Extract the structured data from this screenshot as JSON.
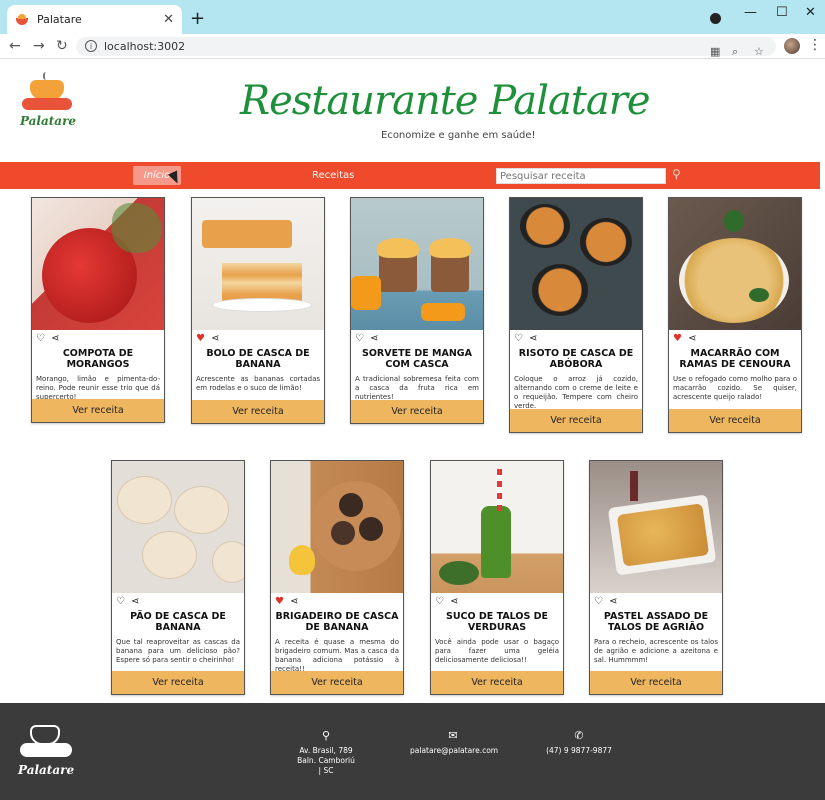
{
  "browser": {
    "tab_title": "Palatare",
    "close": "✕",
    "new_tab": "+",
    "url": "localhost:3002",
    "min": "—",
    "max": "☐",
    "closewin": "✕"
  },
  "header": {
    "logo_text": "Palatare",
    "title": "Restaurante Palatare",
    "subtitle": "Economize e ganhe em saúde!"
  },
  "nav": {
    "inicio": "Início",
    "receitas": "Receitas",
    "search_placeholder": "Pesquisar receita"
  },
  "cards": [
    {
      "title": "COMPOTA DE MORANGOS",
      "desc": "Morango, limão e pimenta-do-reino. Pode reunir esse trio que dá supercerto!",
      "liked": false,
      "button": "Ver receita"
    },
    {
      "title": "BOLO DE CASCA DE BANANA",
      "desc": "Acrescente as bananas cortadas em rodelas e o suco de limão!",
      "liked": true,
      "button": "Ver receita"
    },
    {
      "title": "SORVETE DE MANGA COM CASCA",
      "desc": "A tradicional sobremesa feita com a casca da fruta rica em nutrientes!",
      "liked": false,
      "button": "Ver receita"
    },
    {
      "title": "RISOTO DE CASCA DE ABÓBORA",
      "desc": "Coloque o arroz já cozido, alternando com o creme de leite e o requeijão. Tempere com cheiro verde.",
      "liked": false,
      "button": "Ver receita"
    },
    {
      "title": "MACARRÃO COM RAMAS DE CENOURA",
      "desc": "Use o refogado como molho para o macarrão cozido. Se quiser, acrescente queijo ralado!",
      "liked": true,
      "button": "Ver receita"
    },
    {
      "title": "PÃO DE CASCA DE BANANA",
      "desc": "Que tal reaproveitar as cascas da banana para um delicioso pão? Espere só para sentir o cheirinho!",
      "liked": false,
      "button": "Ver receita"
    },
    {
      "title": "BRIGADEIRO DE CASCA DE BANANA",
      "desc": "A receita é quase a mesma do brigadeiro comum. Mas a casca da banana adiciona potássio à receita!!",
      "liked": true,
      "button": "Ver receita"
    },
    {
      "title": "SUCO DE TALOS DE VERDURAS",
      "desc": "Você ainda pode usar o bagaço para fazer uma geléia deliciosamente deliciosa!!",
      "liked": false,
      "button": "Ver receita"
    },
    {
      "title": "PASTEL ASSADO DE TALOS DE AGRIÃO",
      "desc": "Para o recheio, acrescente os talos de agrião e adicione a azeitona e sal. Hummmm!",
      "liked": false,
      "button": "Ver receita"
    }
  ],
  "footer": {
    "logo_text": "Palatare",
    "address_line1": "Av. Brasil, 789",
    "address_line2": "Baln. Camboriú | SC",
    "email": "palatare@palatare.com",
    "phone": "(47) 9 9877-9877"
  }
}
